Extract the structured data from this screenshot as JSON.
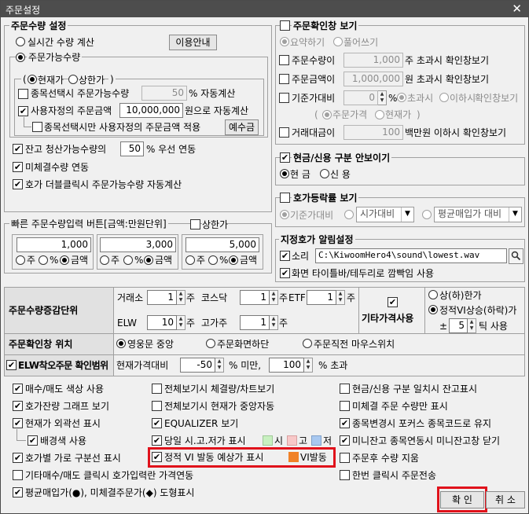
{
  "window": {
    "title": "주문설정",
    "close_glyph": "✕"
  },
  "left_panel": {
    "title": "주문수량 설정",
    "realtime_label": "실시간 수량 계산",
    "guide_button": "이용안내",
    "available_label": "주문가능수량",
    "inner": {
      "current_label": "현재가",
      "upper_label": "상한가",
      "auto_on_select_label": "종목선택시 주문가능수량",
      "auto_on_select_value": "50",
      "auto_on_select_suffix": "% 자동계산",
      "user_amount_label": "사용자정의 주문금액",
      "user_amount_value": "10,000,000",
      "user_amount_suffix": "원으로 자동계산",
      "user_amount_only_label": "종목선택시만 사용자정의 주문금액 적용",
      "deposit_button": "예수금"
    },
    "balance_label": "잔고 청산가능수량의",
    "balance_value": "50",
    "balance_suffix": "% 우선 연동",
    "unfilled_label": "미체결수량 연동",
    "dblclick_label": "호가 더블클릭시 주문가능수량 자동계산"
  },
  "quick": {
    "title": "빠른 주문수량입력 버튼[금액:만원단위]",
    "upper_label": "상한가",
    "boxes": [
      {
        "value": "1,000"
      },
      {
        "value": "3,000"
      },
      {
        "value": "5,000"
      }
    ],
    "opt_stock": "주",
    "opt_pct": "%",
    "opt_amount": "금액"
  },
  "confirm_panel": {
    "title": "주문확인창 보기",
    "summary": "요약하기",
    "expand": "풀어쓰기",
    "qty_label": "주문수량이",
    "qty_value": "1,000",
    "qty_suffix": "주 초과시 확인창보기",
    "amt_label": "주문금액이",
    "amt_value": "1,000,000",
    "amt_suffix": "원 초과시 확인창보기",
    "base_label": "기준가대비",
    "base_value": "0",
    "base_pct": "%",
    "base_over": "초과시",
    "base_under": "이하시",
    "base_suffix": "확인창보기",
    "paren_open": "(",
    "order_price": "주문가격",
    "current_price": "현재가",
    "paren_close": ")",
    "vol_label": "거래대금이",
    "vol_value": "100",
    "vol_suffix": "백만원 이하시 확인창보기"
  },
  "cash_panel": {
    "title": "현금/신용 구분 안보이기",
    "cash": "현 금",
    "credit": "신 용"
  },
  "rate_panel": {
    "title": "호가등락률 보기",
    "base_label": "기준가대비",
    "market_dd": "시가대비",
    "avg_dd": "평균매입가 대비"
  },
  "alert_panel": {
    "title": "지정호가 알림설정",
    "sound_label": "소리",
    "sound_path": "C:\\KiwoomHero4\\sound\\lowest.wav",
    "flash_label": "화면 타이틀바/테두리로 깜빡임 사용"
  },
  "grid": {
    "incr_label": "주문수량증감단위",
    "exch_label": "거래소",
    "exch_value": "1",
    "exch_unit": "주",
    "kosdaq_label": "코스닥",
    "kosdaq_value": "1",
    "kosdaq_unit": "주",
    "etf_label": "ETF",
    "etf_value": "1",
    "etf_unit": "주",
    "elw_label": "ELW",
    "elw_value": "10",
    "elw_unit": "주",
    "high_label": "고가주",
    "high_value": "1",
    "high_unit": "주",
    "other_price_label": "기타가격사용",
    "upper_lower_label": "상(하)한가",
    "vi_label": "정적VI상승(하락)가",
    "pm_label": "±",
    "tick_value": "5",
    "tick_suffix": "틱 사용",
    "pos_label": "주문확인창 위치",
    "pos_center": "영웅문 중앙",
    "pos_screen": "주문화면하단",
    "pos_mouse": "주문직전 마우스위치",
    "elw_range_label": "ELW착오주문 확인범위",
    "cur_label": "현재가격대비",
    "cur_value": "-50",
    "cur_suffix": "% 미만,",
    "over_value": "100",
    "over_suffix": "% 초과"
  },
  "options": [
    {
      "label": "매수/매도 색상 사용",
      "on": true
    },
    {
      "label": "전체보기시 체결량/차트보기",
      "on": false
    },
    {
      "label": "현금/신용 구분 일치시 잔고표시",
      "on": false
    },
    {
      "label": "호가잔량 그래프 보기",
      "on": true
    },
    {
      "label": "전체보기시 현재가 중앙자동",
      "on": false
    },
    {
      "label": "미체결 주문 수량만 표시",
      "on": false
    },
    {
      "label": "현재가 외곽선 표시",
      "on": true
    },
    {
      "label": "EQUALIZER 보기",
      "on": true
    },
    {
      "label": "종목변경시 포커스 종목코드로 유지",
      "on": true
    },
    {
      "label": "배경색 사용",
      "on": true
    },
    {
      "label": "당일 시.고.저가 표시",
      "on": true
    },
    {
      "label": "미니잔고 종목연동시 미니잔고창 닫기",
      "on": true
    },
    {
      "label": "호가별 가로 구분선 표시",
      "on": true
    },
    {
      "label": "정적 VI 발동 예상가 표시",
      "on": true
    },
    {
      "label": "주문후 수량 지움",
      "on": false
    },
    {
      "label": "기타매수/매도 클릭시 호가입력란 가격연동",
      "on": false
    },
    {
      "label": "한번 클릭시 주문전송",
      "on": false
    },
    {
      "label": "평균매입가(●), 미체결주문가(◆) 도형표시",
      "on": true
    }
  ],
  "ohl": {
    "si": "시",
    "go": "고",
    "jeo": "저"
  },
  "vi_trigger_label": "VI발동",
  "buttons": {
    "ok": "확 인",
    "cancel": "취 소"
  },
  "colors": {
    "green": "#c8f0c0",
    "pink": "#f8c8c8",
    "blue": "#a8c8f0",
    "orange": "#f08228",
    "red_highlight": "#e0121b"
  }
}
